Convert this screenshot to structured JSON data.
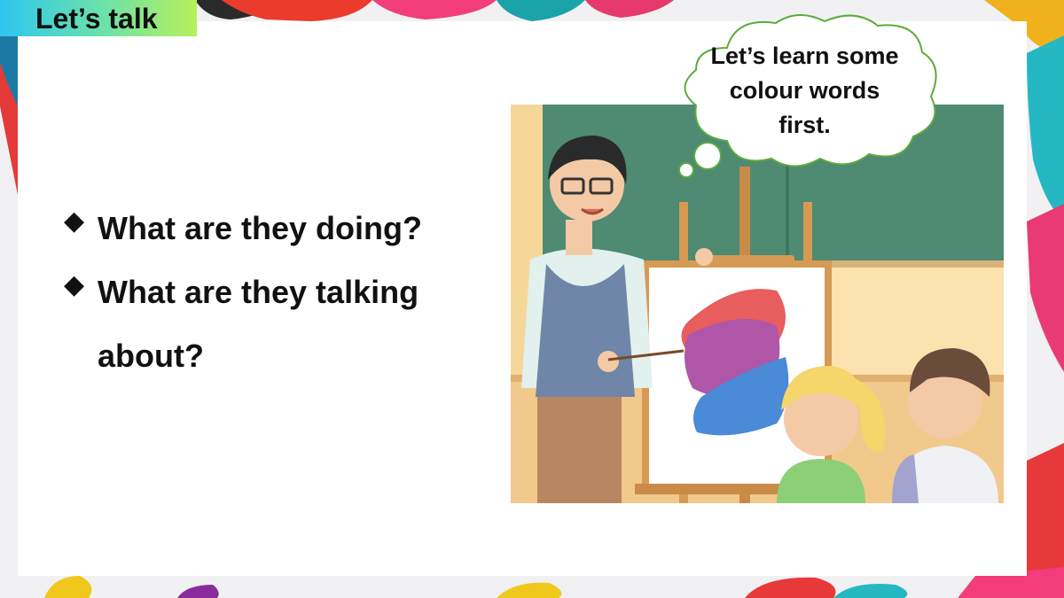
{
  "section_tag": "Let’s talk",
  "questions": [
    {
      "bullet": "◆",
      "text": "What are they doing?"
    },
    {
      "bullet": "◆",
      "text": "What are they talking about?"
    }
  ],
  "speech_bubble": "Let’s learn some colour words first.",
  "colors": {
    "tag_gradient_start": "#2ec6f0",
    "tag_gradient_end": "#b8f05a",
    "chalkboard": "#4f8a73",
    "bubble_border": "#5cab3c"
  }
}
